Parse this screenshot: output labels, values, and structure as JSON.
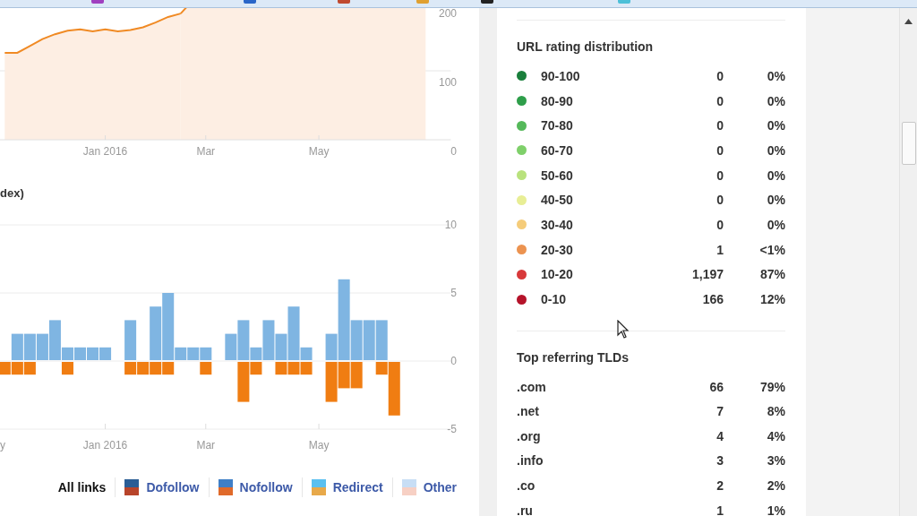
{
  "area_chart": {
    "chart_data": {
      "type": "area",
      "categories": [
        null,
        null,
        null,
        null,
        null,
        null,
        null,
        null,
        "Jan 2016",
        null,
        null,
        null,
        null,
        null,
        null,
        null,
        "Mar",
        null,
        null,
        null,
        null,
        null,
        null,
        null,
        null,
        "May",
        null,
        null,
        null,
        null,
        null,
        null,
        null,
        null
      ],
      "series": [
        {
          "color": "#f08a24",
          "values": [
            126,
            126,
            136,
            146,
            153,
            158,
            160,
            157,
            160,
            157,
            159,
            163,
            170,
            178,
            183,
            null,
            null,
            null,
            null,
            null,
            null,
            null,
            null,
            null,
            null,
            null,
            null,
            null,
            null,
            null,
            null,
            null,
            null,
            null
          ]
        }
      ],
      "ylim": [
        0,
        200
      ],
      "yticks": [
        0,
        100,
        200
      ]
    }
  },
  "bar_chart": {
    "title": "dex)",
    "chart_data": {
      "type": "bar",
      "categories": [
        "y",
        null,
        null,
        null,
        null,
        null,
        null,
        null,
        "Jan 2016",
        null,
        null,
        null,
        null,
        null,
        null,
        null,
        "Mar",
        null,
        null,
        null,
        null,
        null,
        null,
        null,
        null,
        "May",
        null,
        null,
        null,
        null,
        null,
        null,
        null,
        null,
        null,
        null
      ],
      "series": [
        {
          "color": "#7fb5e2",
          "values": [
            0,
            2,
            2,
            2,
            3,
            1,
            1,
            1,
            1,
            0,
            3,
            0,
            4,
            5,
            1,
            1,
            1,
            0,
            2,
            3,
            1,
            3,
            2,
            4,
            1,
            0,
            2,
            6,
            3,
            3,
            3,
            0,
            null,
            null,
            null,
            null
          ]
        },
        {
          "color": "#f07d12",
          "values": [
            -1,
            -1,
            -1,
            0,
            0,
            -1,
            0,
            0,
            0,
            0,
            -1,
            -1,
            -1,
            -1,
            0,
            0,
            -1,
            0,
            0,
            -3,
            -1,
            0,
            -1,
            -1,
            -1,
            0,
            -3,
            -2,
            -2,
            0,
            -1,
            -4,
            null,
            null,
            null,
            null
          ]
        }
      ],
      "stacked": true,
      "ylim": [
        -5,
        10
      ],
      "yticks": [
        -5,
        0,
        5,
        10
      ]
    }
  },
  "legend": [
    {
      "label": "All links",
      "selected": true
    },
    {
      "label": "Dofollow",
      "selected": false,
      "swatch": [
        {
          "color": "#2a5d95"
        },
        {
          "color": "#b8442a"
        }
      ]
    },
    {
      "label": "Nofollow",
      "selected": false,
      "swatch": [
        {
          "color": "#3f7fc7"
        },
        {
          "color": "#e06a2a"
        }
      ]
    },
    {
      "label": "Redirect",
      "selected": false,
      "swatch": [
        {
          "color": "#5bc0f0"
        },
        {
          "color": "#e8a94a"
        }
      ]
    },
    {
      "label": "Other",
      "selected": false,
      "swatch": [
        {
          "color": "#c8def5"
        },
        {
          "color": "#f7d0c4"
        }
      ]
    }
  ],
  "url_rating": {
    "title": "URL rating distribution",
    "rows": [
      {
        "range": "90-100",
        "count": "0",
        "percent": "0%",
        "color": "#1a7f3c"
      },
      {
        "range": "80-90",
        "count": "0",
        "percent": "0%",
        "color": "#2e9e4a"
      },
      {
        "range": "70-80",
        "count": "0",
        "percent": "0%",
        "color": "#55b95a"
      },
      {
        "range": "60-70",
        "count": "0",
        "percent": "0%",
        "color": "#7fd06a"
      },
      {
        "range": "50-60",
        "count": "0",
        "percent": "0%",
        "color": "#b9e27d"
      },
      {
        "range": "40-50",
        "count": "0",
        "percent": "0%",
        "color": "#e8ee95"
      },
      {
        "range": "30-40",
        "count": "0",
        "percent": "0%",
        "color": "#f5cc7a"
      },
      {
        "range": "20-30",
        "count": "1",
        "percent": "<1%",
        "color": "#ec9350"
      },
      {
        "range": "10-20",
        "count": "1,197",
        "percent": "87%",
        "color": "#d8393a"
      },
      {
        "range": "0-10",
        "count": "166",
        "percent": "12%",
        "color": "#b5132a"
      }
    ]
  },
  "tlds": {
    "title": "Top referring TLDs",
    "rows": [
      {
        "tld": ".com",
        "count": "66",
        "percent": "79%"
      },
      {
        "tld": ".net",
        "count": "7",
        "percent": "8%"
      },
      {
        "tld": ".org",
        "count": "4",
        "percent": "4%"
      },
      {
        "tld": ".info",
        "count": "3",
        "percent": "3%"
      },
      {
        "tld": ".co",
        "count": "2",
        "percent": "2%"
      },
      {
        "tld": ".ru",
        "count": "1",
        "percent": "1%"
      }
    ]
  }
}
